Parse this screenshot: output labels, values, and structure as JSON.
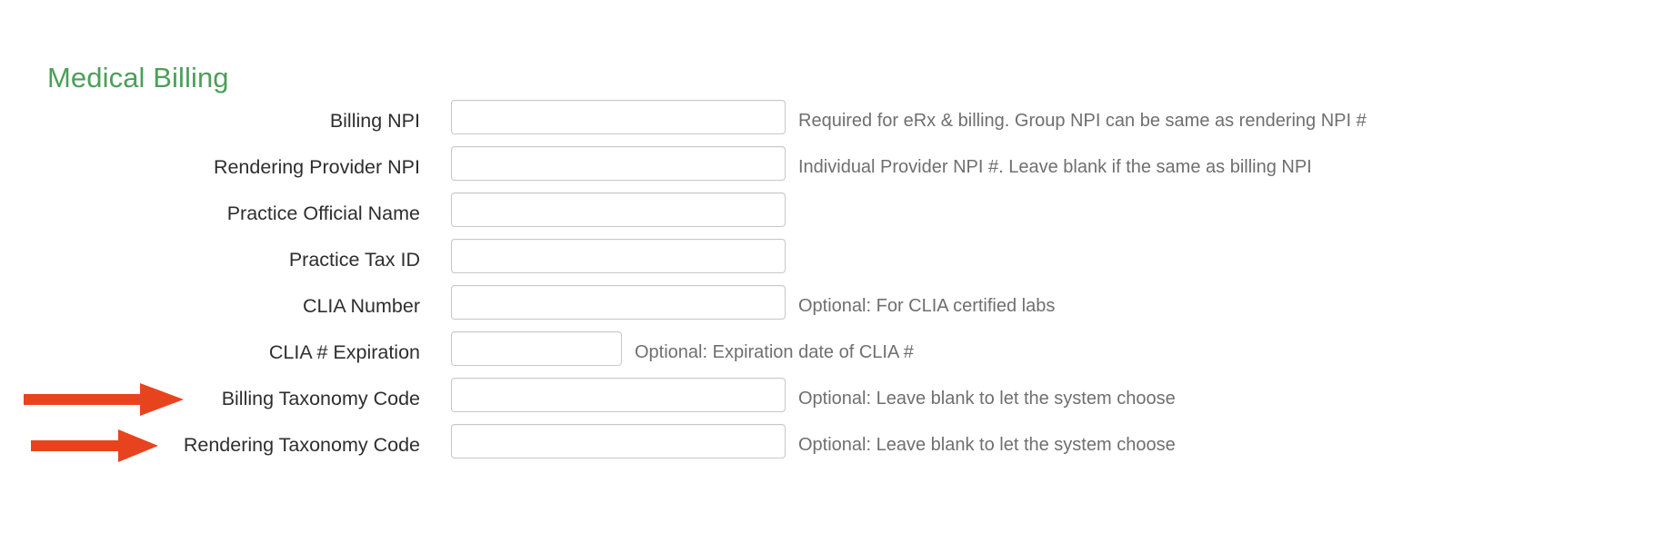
{
  "section": {
    "title": "Medical Billing",
    "title_color": "#4d9e5a"
  },
  "annotations": {
    "arrow_color": "#e8431f",
    "arrows": [
      {
        "name": "arrow-billing-taxonomy",
        "target": "Billing Taxonomy Code"
      },
      {
        "name": "arrow-rendering-taxonomy",
        "target": "Rendering Taxonomy Code"
      }
    ]
  },
  "form": {
    "rows": [
      {
        "label": "Billing NPI",
        "value": "",
        "placeholder": "",
        "helper": "Required for eRx & billing. Group NPI can be same as rendering NPI #",
        "width": "wide",
        "arrow": false
      },
      {
        "label": "Rendering Provider NPI",
        "value": "",
        "placeholder": "",
        "helper": "Individual Provider NPI #. Leave blank if the same as billing NPI",
        "width": "wide",
        "arrow": false
      },
      {
        "label": "Practice Official Name",
        "value": "",
        "placeholder": "",
        "helper": "",
        "width": "wide",
        "arrow": false
      },
      {
        "label": "Practice Tax ID",
        "value": "",
        "placeholder": "",
        "helper": "",
        "width": "wide",
        "arrow": false
      },
      {
        "label": "CLIA Number",
        "value": "",
        "placeholder": "",
        "helper": "Optional: For CLIA certified labs",
        "width": "wide",
        "arrow": false
      },
      {
        "label": "CLIA # Expiration",
        "value": "",
        "placeholder": "",
        "helper": "Optional: Expiration date of CLIA #",
        "width": "narrow",
        "arrow": false
      },
      {
        "label": "Billing Taxonomy Code",
        "value": "",
        "placeholder": "",
        "helper": "Optional: Leave blank to let the system choose",
        "width": "wide",
        "arrow": true
      },
      {
        "label": "Rendering Taxonomy Code",
        "value": "",
        "placeholder": "",
        "helper": "Optional: Leave blank to let the system choose",
        "width": "wide",
        "arrow": true
      }
    ]
  }
}
